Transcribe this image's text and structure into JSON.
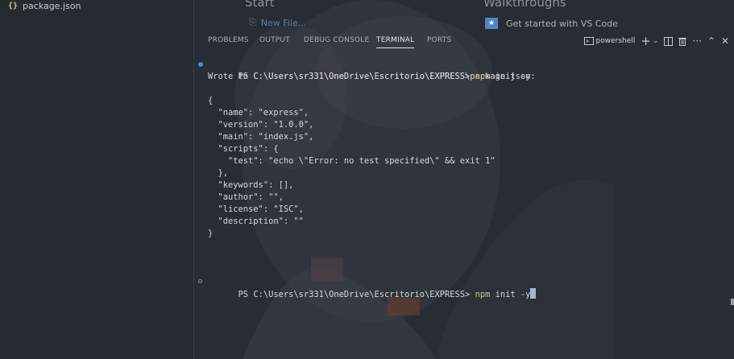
{
  "explorer": {
    "file": {
      "icon": "json-icon",
      "icon_glyph": "{}",
      "name": "package.json"
    }
  },
  "welcome": {
    "start_heading": "Start",
    "new_file": "New File...",
    "walkthroughs_heading": "Walkthroughs",
    "get_started": "Get started with VS Code"
  },
  "panel": {
    "tabs": [
      {
        "label": "PROBLEMS",
        "active": false
      },
      {
        "label": "OUTPUT",
        "active": false
      },
      {
        "label": "DEBUG CONSOLE",
        "active": false
      },
      {
        "label": "TERMINAL",
        "active": true
      },
      {
        "label": "PORTS",
        "active": false
      }
    ],
    "actions": {
      "shell_label": "powershell",
      "icons": [
        "terminal-icon",
        "plus-icon",
        "chevron-down-icon",
        "split-icon",
        "trash-icon",
        "more-icon",
        "chevron-up-icon",
        "close-icon"
      ]
    }
  },
  "terminal": {
    "prompt": "PS C:\\Users\\sr331\\OneDrive\\Escritorio\\EXPRESS> ",
    "cmd_word": "npm",
    "cmd_rest": " init -y",
    "lines": [
      "Wrote to C:\\Users\\sr331\\OneDrive\\Escritorio\\EXPRESS\\package.json:",
      "",
      "{",
      "  \"name\": \"express\",",
      "  \"version\": \"1.0.0\",",
      "  \"main\": \"index.js\",",
      "  \"scripts\": {",
      "    \"test\": \"echo \\\"Error: no test specified\\\" && exit 1\"",
      "  },",
      "  \"keywords\": [],",
      "  \"author\": \"\",",
      "  \"license\": \"ISC\",",
      "  \"description\": \"\"",
      "}",
      "",
      "",
      ""
    ]
  },
  "colors": {
    "accent": "#3f8ede",
    "command": "#e5c07b",
    "background": "#282c34"
  }
}
